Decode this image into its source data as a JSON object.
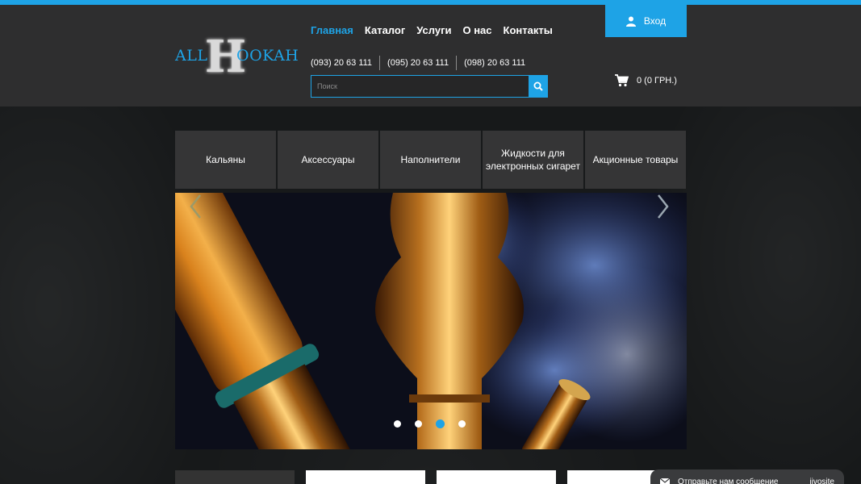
{
  "logo": {
    "part1": "ALL",
    "part2": "H",
    "part3": "OOKAH"
  },
  "nav": [
    {
      "label": "Главная",
      "active": true
    },
    {
      "label": "Каталог",
      "active": false
    },
    {
      "label": "Услуги",
      "active": false
    },
    {
      "label": "О нас",
      "active": false
    },
    {
      "label": "Контакты",
      "active": false
    }
  ],
  "phones": [
    "(093) 20 63 111",
    "(095) 20 63 111",
    "(098) 20 63 111"
  ],
  "search": {
    "placeholder": "Поиск",
    "icon": "search-icon"
  },
  "login": {
    "label": "Вход",
    "icon": "user-icon"
  },
  "cart": {
    "label": "0 (0 ГРН.)",
    "icon": "cart-icon"
  },
  "categories": [
    "Кальяны",
    "Аксессуары",
    "Наполнители",
    "Жидкости для электронных сигарет",
    "Акционные товары"
  ],
  "slider": {
    "slide_count": 4,
    "active_index": 2,
    "prev_icon": "chevron-left-icon",
    "next_icon": "chevron-right-icon"
  },
  "chat": {
    "label": "Отправьте нам сообщение",
    "brand": "jivosite",
    "icon": "envelope-icon"
  },
  "colors": {
    "accent": "#1ea3e6",
    "header_bg": "#2e2e2f",
    "tile_bg": "#353536"
  }
}
